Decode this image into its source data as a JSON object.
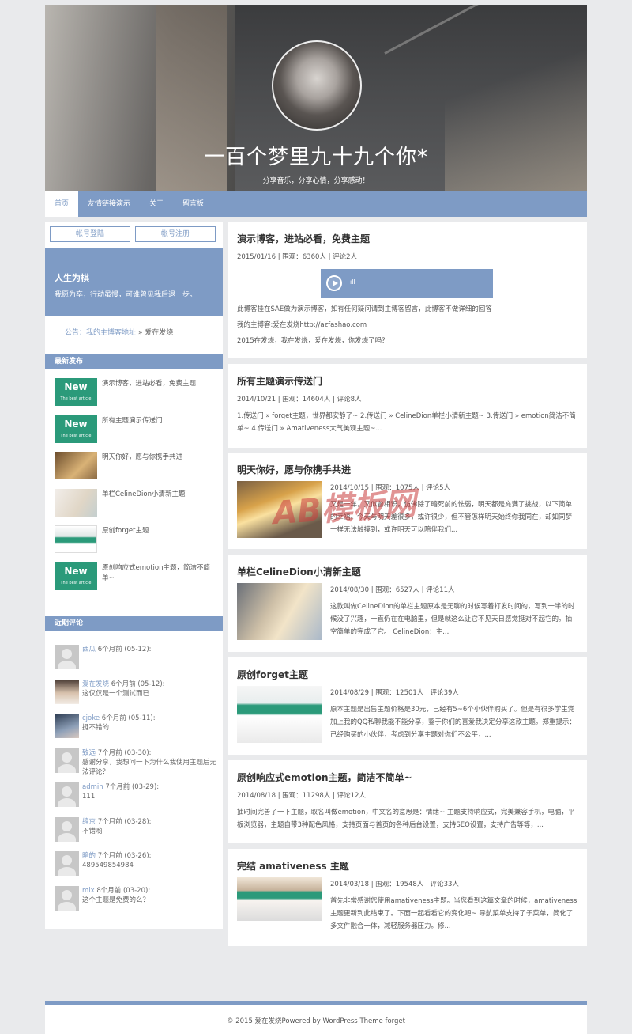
{
  "header": {
    "title": "一百个梦里九十九个你*",
    "subtitle": "分享音乐，分享心情，分享感动！"
  },
  "nav": [
    "首页",
    "友情链接演示",
    "关于",
    "留言板"
  ],
  "sidebar": {
    "login_label": "帐号登陆",
    "register_label": "帐号注册",
    "motto_title": "人生为棋",
    "motto_text": "我愿为卒，行动虽慢，可谁曾见我后退一步。",
    "notice_label": "公告：我的主博客地址",
    "notice_text": " » 爱在发烧",
    "recent_title": "最新发布",
    "new_badge": "New",
    "new_badge_sub": "The best article",
    "recent_posts": [
      "演示博客，进站必看，免费主题",
      "所有主题演示传送门",
      "明天你好，愿与你携手共进",
      "单栏CelineDion小清新主题",
      "原创forget主题",
      "原创响应式emotion主题，简洁不简单~"
    ],
    "comments_title": "近期评论",
    "comments": [
      {
        "name": "西瓜",
        "time": "6个月前 (05-12):",
        "text": ""
      },
      {
        "name": "爱在发烧",
        "time": "6个月前 (05-12):",
        "text": "这仅仅是一个测试而已"
      },
      {
        "name": "cjoke",
        "time": "6个月前 (05-11):",
        "text": "挺不错的"
      },
      {
        "name": "致远",
        "time": "7个月前 (03-30):",
        "text": "感谢分享，我想问一下为什么我使用主题后无法评论？"
      },
      {
        "name": "admin",
        "time": "7个月前 (03-29):",
        "text": "111"
      },
      {
        "name": "缠京",
        "time": "7个月前 (03-28):",
        "text": "不错哟"
      },
      {
        "name": "暗的",
        "time": "7个月前 (03-26):",
        "text": "489549854984"
      },
      {
        "name": "mix",
        "time": "8个月前 (03-20):",
        "text": "这个主题是免费的么？"
      }
    ]
  },
  "posts": [
    {
      "title": "演示博客，进站必看，免费主题",
      "meta": "2015/01/16 | 围观：6360人 | 评论2人",
      "player_bars": "ıll",
      "lines": [
        "此博客挂在SAE做为演示博客，如有任何疑问请到主博客留言，此博客不做详细的回答",
        "我的主博客:爱在发烧http://azfashao.com",
        "2015在发烧，我在发烧，爱在发烧，你发烧了吗？"
      ]
    },
    {
      "title": "所有主题演示传送门",
      "meta": "2014/10/21 | 围观：14604人 | 评论8人",
      "excerpt": "1.传送门 » forget主题，世界都安静了~ 2.传送门 » CelineDion单栏小清新主题~ 3.传送门 » emotion简洁不简单~ 4.传送门 » Amativeness大气美观主题~..."
    },
    {
      "title": "明天你好，愿与你携手共进",
      "meta": "2014/10/15 | 围观：1075人 | 评论5人",
      "excerpt": "又是一年，又似曾相识，仿佛除了暗死前的怯弱，明天都是充满了挑战，以下简单的幸福。今天与明天差很多，或许很少，但不管怎样明天始终你我同在，却如同梦一样无法触摸到，或许明天可以陪伴我们..."
    },
    {
      "title": "单栏CelineDion小清新主题",
      "meta": "2014/08/30 | 围观：6527人 | 评论11人",
      "excerpt": "这款叫做CelineDion的单栏主题原本是无聊的时候写着打发时间的，写到一半的时候没了兴趣，一直仍在在电脑里，但是就这么让它不见天日感觉挺对不起它的。抽空简单的完成了它。 CelineDion：主..."
    },
    {
      "title": "原创forget主题",
      "meta": "2014/08/29 | 围观：12501人 | 评论39人",
      "excerpt": "原本主题是出售主题价格是30元，已经有5~6个小伙伴购买了。但是有很多学生党加上我的QQ私聊我能不能分享，鉴于你们的喜爱我决定分享这款主题。郑重提示：已经购买的小伙伴，考虑到分享主题对你们不公平，..."
    },
    {
      "title": "原创响应式emotion主题，简洁不简单~",
      "meta": "2014/08/18 | 围观：11298人 | 评论12人",
      "excerpt": "抽时间完善了一下主题，取名叫做emotion，中文名的意思是：情绪~ 主题支持响应式，完美兼容手机，电脑，平板浏览器，主题自带3种配色风格，支持页面与首页的各种后台设置，支持SEO设置，支持广告等等，..."
    },
    {
      "title": "完结 amativeness 主题",
      "meta": "2014/03/18 | 围观：19548人 | 评论33人",
      "excerpt": "首先非常感谢您使用amativeness主题。当您看到这篇文章的时候，amativeness主题更新到此结束了。下面一起看看它的变化吧~ 导航菜单支持了子菜单，简化了多文件融合一体，减轻服务器压力。修..."
    }
  ],
  "watermark": "AB模板网",
  "footer": "© 2015 爱在发烧Powered by WordPress Theme forget",
  "colors": {
    "accent": "#7e9bc5",
    "badge": "#2b9a7a",
    "background": "#e9eaec"
  }
}
